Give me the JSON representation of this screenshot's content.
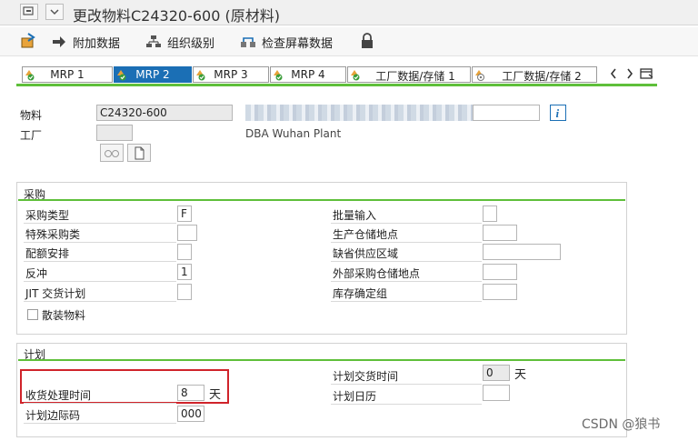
{
  "window": {
    "title": "更改物料C24320-600 (原材料)"
  },
  "toolbar": {
    "items": [
      "附加数据",
      "组织级别",
      "检查屏幕数据"
    ]
  },
  "tabs": [
    "MRP 1",
    "MRP 2",
    "MRP 3",
    "MRP 4",
    "工厂数据/存储 1",
    "工厂数据/存储 2"
  ],
  "header": {
    "material_label": "物料",
    "material_value": "C24320-600",
    "plant_label": "工厂",
    "plant_desc": "DBA Wuhan Plant"
  },
  "procurement": {
    "title": "采购",
    "left_rows": [
      {
        "label": "采购类型",
        "value": "F"
      },
      {
        "label": "特殊采购类",
        "value": ""
      },
      {
        "label": "配额安排",
        "value": ""
      },
      {
        "label": "反冲",
        "value": "1"
      },
      {
        "label": "JIT 交货计划",
        "value": ""
      }
    ],
    "bulk_label": "散装物料",
    "right_rows": [
      {
        "label": "批量输入",
        "value": ""
      },
      {
        "label": "生产仓储地点",
        "value": ""
      },
      {
        "label": "缺省供应区域",
        "value": ""
      },
      {
        "label": "外部采购仓储地点",
        "value": ""
      },
      {
        "label": "库存确定组",
        "value": ""
      }
    ]
  },
  "planning": {
    "title": "计划",
    "gr_time_label": "收货处理时间",
    "gr_time_value": "8",
    "gr_time_unit": "天",
    "margin_key_label": "计划边际码",
    "margin_key_value": "000",
    "planned_del_label": "计划交货时间",
    "planned_del_value": "0",
    "planned_del_unit": "天",
    "calendar_label": "计划日历",
    "calendar_value": ""
  },
  "watermark": "CSDN @狼书"
}
